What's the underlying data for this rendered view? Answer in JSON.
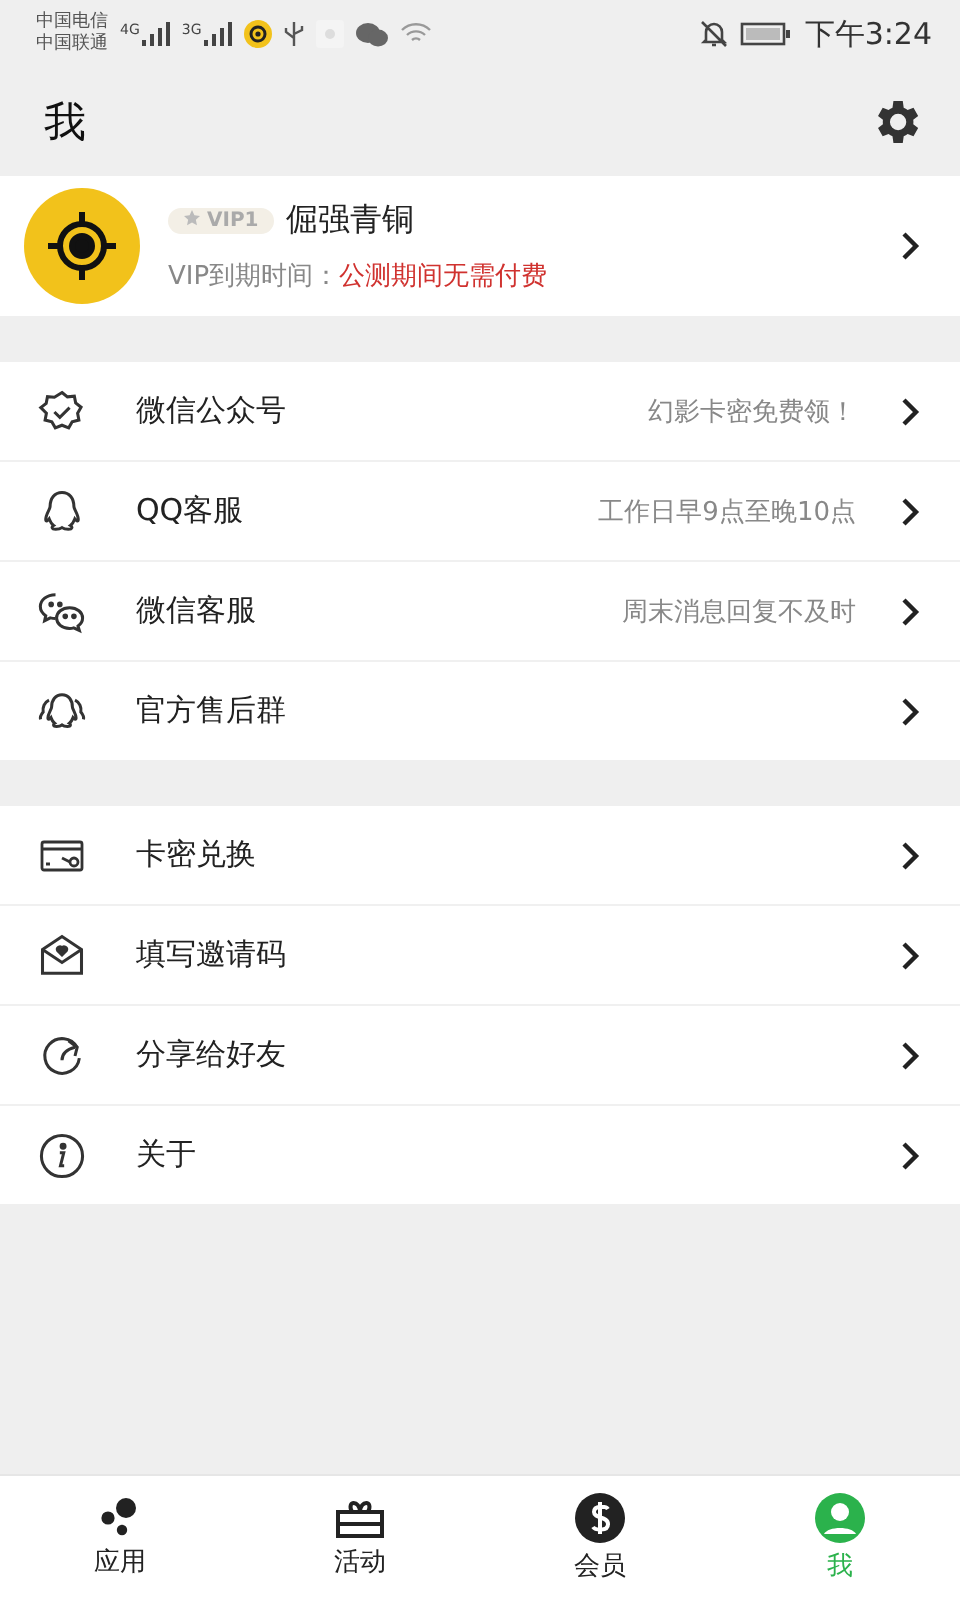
{
  "status_bar": {
    "carriers": [
      "中国电信",
      "中国联通"
    ],
    "networks": [
      "4G",
      "3G"
    ],
    "time": "下午3:24"
  },
  "header": {
    "title": "我"
  },
  "profile": {
    "badge": "VIP1",
    "name": "倔强青铜",
    "expiry_label": "VIP到期时间：",
    "expiry_value": "公测期间无需付费"
  },
  "sections": [
    {
      "items": [
        {
          "label": "微信公众号",
          "note": "幻影卡密免费领！"
        },
        {
          "label": "QQ客服",
          "note": "工作日早9点至晚10点"
        },
        {
          "label": "微信客服",
          "note": "周末消息回复不及时"
        },
        {
          "label": "官方售后群"
        }
      ]
    },
    {
      "items": [
        {
          "label": "卡密兑换"
        },
        {
          "label": "填写邀请码"
        },
        {
          "label": "分享给好友"
        },
        {
          "label": "关于"
        }
      ]
    }
  ],
  "bottom_nav": [
    {
      "label": "应用",
      "selected": false
    },
    {
      "label": "活动",
      "selected": false
    },
    {
      "label": "会员",
      "selected": false
    },
    {
      "label": "我",
      "selected": true
    }
  ]
}
